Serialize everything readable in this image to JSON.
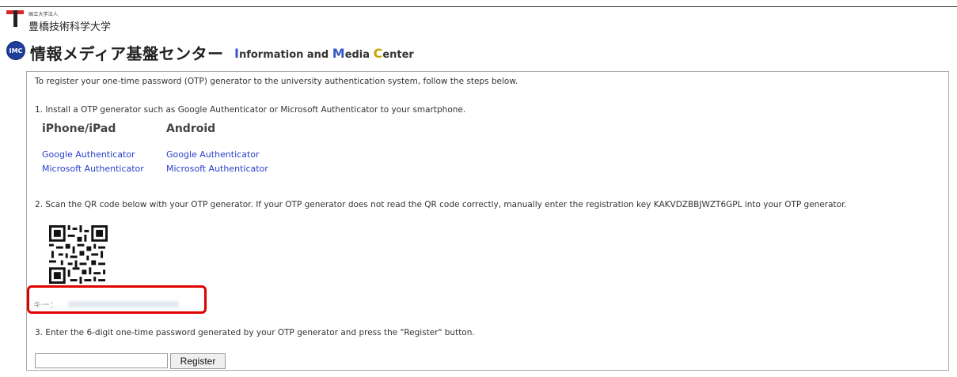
{
  "header": {
    "org_small": "国立大学法人",
    "university": "豊橋技術科学大学",
    "badge": "IMC",
    "center_ja": "情報メディア基盤センター",
    "center_en": {
      "I": "I",
      "nformation": "nformation and ",
      "M": "M",
      "edia": "edia ",
      "C": "C",
      "enter": "enter"
    }
  },
  "content": {
    "intro": "To register your one-time password (OTP) generator to the university authentication system, follow the steps below.",
    "step1": "1. Install a OTP generator such as Google Authenticator or Microsoft Authenticator to your smartphone.",
    "col_iphone": "iPhone/iPad",
    "col_android": "Android",
    "iphone_links": [
      "Google Authenticator",
      "Microsoft Authenticator"
    ],
    "android_links": [
      "Google Authenticator",
      "Microsoft Authenticator"
    ],
    "step2": "2. Scan the QR code below with your OTP generator. If your OTP generator does not read the QR code correctly, manually enter the registration key KAKVDZBBJWZT6GPL into your OTP generator.",
    "key_label": "キー：",
    "step3": "3. Enter the 6-digit one-time password generated by your OTP generator and press the \"Register\" button.",
    "otp_value": "",
    "register_label": "Register"
  },
  "colors": {
    "link": "#2a3ecc",
    "highlight": "#e00000",
    "brand": "#1f3f9a"
  }
}
